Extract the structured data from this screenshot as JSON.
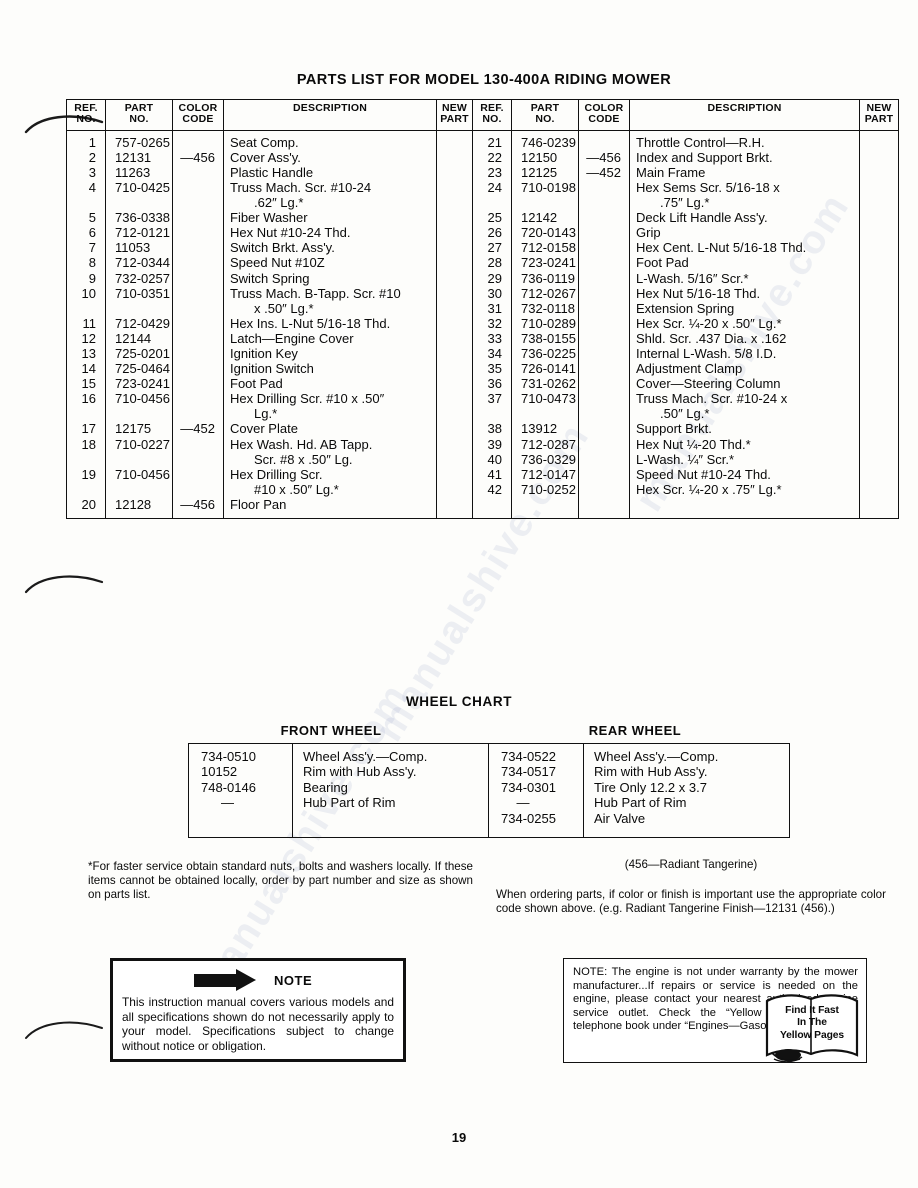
{
  "page": {
    "number": "19"
  },
  "parts_list": {
    "title": "PARTS LIST FOR MODEL 130-400A RIDING MOWER",
    "columns": {
      "ref_no": "REF.\nNO.",
      "ref_no_line1": "REF.",
      "ref_no_line2": "NO.",
      "part_no_line1": "PART",
      "part_no_line2": "NO.",
      "color_code_line1": "COLOR",
      "color_code_line2": "CODE",
      "description": "DESCRIPTION",
      "new_part_line1": "NEW",
      "new_part_line2": "PART"
    },
    "left_rows": [
      {
        "ref": "1",
        "part": "757-0265",
        "color": "",
        "desc": [
          "Seat Comp."
        ]
      },
      {
        "ref": "2",
        "part": "12131",
        "color": "—456",
        "desc": [
          "Cover Ass'y."
        ]
      },
      {
        "ref": "3",
        "part": "11263",
        "color": "",
        "desc": [
          "Plastic Handle"
        ]
      },
      {
        "ref": "4",
        "part": "710-0425",
        "color": "",
        "desc": [
          "Truss Mach. Scr. #10-24",
          ".62″ Lg.*"
        ]
      },
      {
        "ref": "5",
        "part": "736-0338",
        "color": "",
        "desc": [
          "Fiber Washer"
        ]
      },
      {
        "ref": "6",
        "part": "712-0121",
        "color": "",
        "desc": [
          "Hex Nut #10-24 Thd."
        ]
      },
      {
        "ref": "7",
        "part": "11053",
        "color": "",
        "desc": [
          "Switch Brkt. Ass'y."
        ]
      },
      {
        "ref": "8",
        "part": "712-0344",
        "color": "",
        "desc": [
          "Speed Nut #10Z"
        ]
      },
      {
        "ref": "9",
        "part": "732-0257",
        "color": "",
        "desc": [
          "Switch Spring"
        ]
      },
      {
        "ref": "10",
        "part": "710-0351",
        "color": "",
        "desc": [
          "Truss Mach. B-Tapp. Scr. #10",
          "x .50″ Lg.*"
        ]
      },
      {
        "ref": "11",
        "part": "712-0429",
        "color": "",
        "desc": [
          "Hex Ins. L-Nut 5/16-18 Thd."
        ]
      },
      {
        "ref": "12",
        "part": "12144",
        "color": "",
        "desc": [
          "Latch—Engine Cover"
        ]
      },
      {
        "ref": "13",
        "part": "725-0201",
        "color": "",
        "desc": [
          "Ignition Key"
        ]
      },
      {
        "ref": "14",
        "part": "725-0464",
        "color": "",
        "desc": [
          "Ignition Switch"
        ]
      },
      {
        "ref": "15",
        "part": "723-0241",
        "color": "",
        "desc": [
          "Foot Pad"
        ]
      },
      {
        "ref": "16",
        "part": "710-0456",
        "color": "",
        "desc": [
          "Hex Drilling Scr. #10 x .50″",
          "Lg.*"
        ]
      },
      {
        "ref": "17",
        "part": "12175",
        "color": "—452",
        "desc": [
          "Cover Plate"
        ]
      },
      {
        "ref": "18",
        "part": "710-0227",
        "color": "",
        "desc": [
          "Hex Wash. Hd. AB Tapp.",
          "Scr. #8 x .50″ Lg."
        ]
      },
      {
        "ref": "19",
        "part": "710-0456",
        "color": "",
        "desc": [
          "Hex Drilling Scr.",
          "#10 x .50″ Lg.*"
        ]
      },
      {
        "ref": "20",
        "part": "12128",
        "color": "—456",
        "desc": [
          "Floor Pan"
        ]
      }
    ],
    "right_rows": [
      {
        "ref": "21",
        "part": "746-0239",
        "color": "",
        "desc": [
          "Throttle Control—R.H."
        ]
      },
      {
        "ref": "22",
        "part": "12150",
        "color": "—456",
        "desc": [
          "Index and Support Brkt."
        ]
      },
      {
        "ref": "23",
        "part": "12125",
        "color": "—452",
        "desc": [
          "Main Frame"
        ]
      },
      {
        "ref": "24",
        "part": "710-0198",
        "color": "",
        "desc": [
          "Hex Sems Scr. 5/16-18 x",
          ".75″ Lg.*"
        ]
      },
      {
        "ref": "25",
        "part": "12142",
        "color": "",
        "desc": [
          "Deck Lift Handle Ass'y."
        ]
      },
      {
        "ref": "26",
        "part": "720-0143",
        "color": "",
        "desc": [
          "Grip"
        ]
      },
      {
        "ref": "27",
        "part": "712-0158",
        "color": "",
        "desc": [
          "Hex Cent. L-Nut 5/16-18 Thd."
        ]
      },
      {
        "ref": "28",
        "part": "723-0241",
        "color": "",
        "desc": [
          "Foot Pad"
        ]
      },
      {
        "ref": "29",
        "part": "736-0119",
        "color": "",
        "desc": [
          "L-Wash. 5/16″ Scr.*"
        ]
      },
      {
        "ref": "30",
        "part": "712-0267",
        "color": "",
        "desc": [
          "Hex Nut 5/16-18 Thd."
        ]
      },
      {
        "ref": "31",
        "part": "732-0118",
        "color": "",
        "desc": [
          "Extension Spring"
        ]
      },
      {
        "ref": "32",
        "part": "710-0289",
        "color": "",
        "desc": [
          "Hex Scr. ¼-20 x .50″ Lg.*"
        ]
      },
      {
        "ref": "33",
        "part": "738-0155",
        "color": "",
        "desc": [
          "Shld. Scr. .437 Dia. x .162"
        ]
      },
      {
        "ref": "34",
        "part": "736-0225",
        "color": "",
        "desc": [
          "Internal L-Wash. 5/8 I.D."
        ]
      },
      {
        "ref": "35",
        "part": "726-0141",
        "color": "",
        "desc": [
          "Adjustment Clamp"
        ]
      },
      {
        "ref": "36",
        "part": "731-0262",
        "color": "",
        "desc": [
          "Cover—Steering Column"
        ]
      },
      {
        "ref": "37",
        "part": "710-0473",
        "color": "",
        "desc": [
          "Truss Mach. Scr. #10-24 x",
          ".50″ Lg.*"
        ]
      },
      {
        "ref": "38",
        "part": "13912",
        "color": "",
        "desc": [
          "Support Brkt."
        ]
      },
      {
        "ref": "39",
        "part": "712-0287",
        "color": "",
        "desc": [
          "Hex Nut ¼-20 Thd.*"
        ]
      },
      {
        "ref": "40",
        "part": "736-0329",
        "color": "",
        "desc": [
          "L-Wash. ¼″ Scr.*"
        ]
      },
      {
        "ref": "41",
        "part": "712-0147",
        "color": "",
        "desc": [
          "Speed Nut #10-24 Thd."
        ]
      },
      {
        "ref": "42",
        "part": "710-0252",
        "color": "",
        "desc": [
          "Hex Scr. ¼-20 x .75″ Lg.*"
        ]
      }
    ]
  },
  "wheel_chart": {
    "title": "WHEEL CHART",
    "front_heading": "FRONT WHEEL",
    "rear_heading": "REAR WHEEL",
    "front_rows": [
      {
        "part": "734-0510",
        "desc": "Wheel Ass'y.—Comp."
      },
      {
        "part": "10152",
        "desc": "Rim with Hub Ass'y."
      },
      {
        "part": "748-0146",
        "desc": "Bearing"
      },
      {
        "part": "—",
        "desc": "Hub Part of Rim"
      }
    ],
    "rear_rows": [
      {
        "part": "734-0522",
        "desc": "Wheel Ass'y.—Comp."
      },
      {
        "part": "734-0517",
        "desc": "Rim with Hub Ass'y."
      },
      {
        "part": "734-0301",
        "desc": "Tire Only 12.2 x 3.7"
      },
      {
        "part": "—",
        "desc": "Hub Part of Rim"
      },
      {
        "part": "734-0255",
        "desc": "Air Valve"
      }
    ]
  },
  "footnotes": {
    "asterisk_note": "*For faster service obtain standard nuts, bolts and washers locally. If these items cannot be obtained locally, order by part number and size as shown on parts list.",
    "color_code_legend": "(456—Radiant Tangerine)",
    "ordering_note": "When ordering parts, if color or finish is important use the appropriate color code shown above. (e.g. Radiant Tangerine Finish—12131 (456).)"
  },
  "note_box": {
    "label": "NOTE",
    "body": "This instruction manual covers various models and all specifications shown do not necessarily apply to your model. Specifications subject to change without notice or obligation."
  },
  "engine_note_box": {
    "body": "NOTE: The engine is not under warranty by the mower manufacturer...If repairs or service is needed on the engine, please contact your nearest authorized engine service outlet. Check the “Yellow Pages” of your telephone book under “Engines—Gasoline.”",
    "yellow_pages_line1": "Find It Fast",
    "yellow_pages_line2": "In The",
    "yellow_pages_line3": "Yellow Pages"
  },
  "colors": {
    "ink": "#0a0a0a",
    "paper": "#fdfdfb"
  }
}
